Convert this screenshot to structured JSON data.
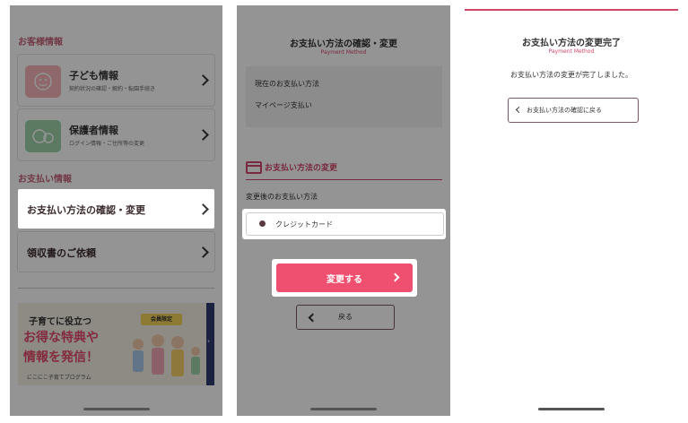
{
  "screen1": {
    "customer_section": "お客様情報",
    "child_card": {
      "title": "子ども情報",
      "subtitle": "契約状況の確認・解約・転園手続き"
    },
    "guardian_card": {
      "title": "保護者情報",
      "subtitle": "ログイン情報・ご住所等の変更"
    },
    "payment_section": "お支払い情報",
    "payment_method_item": "お支払い方法の確認・変更",
    "receipt_item": "領収書のご依頼",
    "banner": {
      "line1": "子育てに役立つ",
      "line2": "お得な特典や",
      "line3": "情報を発信！",
      "flag": "会員限定",
      "program": "にこにこ子育てプログラム"
    }
  },
  "screen2": {
    "title": "お支払い方法の確認・変更",
    "subtitle": "Payment Method",
    "current_label": "現在のお支払い方法",
    "current_value": "マイページ支払い",
    "change_heading": "お支払い方法の変更",
    "after_label": "変更後のお支払い方法",
    "option_credit": "クレジットカード",
    "change_button": "変更する",
    "back_button": "戻る"
  },
  "screen3": {
    "title": "お支払い方法の変更完了",
    "subtitle": "Payment Method",
    "message": "お支払い方法の変更が完了しました。",
    "return_button": "お支払い方法の確認に戻る"
  },
  "colors": {
    "accent": "#d1476a",
    "button": "#f0506f"
  }
}
